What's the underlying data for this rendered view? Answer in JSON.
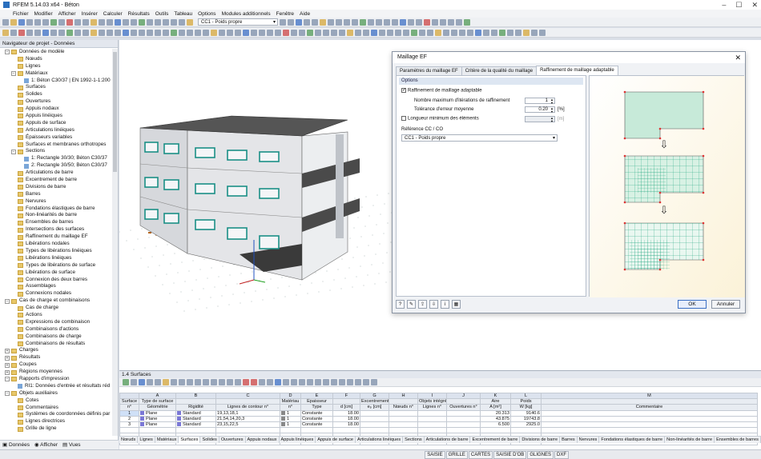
{
  "window": {
    "title": "RFEM 5.14.03 x64 - Béton"
  },
  "menu": [
    "Fichier",
    "Modifier",
    "Afficher",
    "Insérer",
    "Calculer",
    "Résultats",
    "Outils",
    "Tableau",
    "Options",
    "Modules additionnels",
    "Fenêtre",
    "Aide"
  ],
  "toolbar": {
    "loadcase": "CC1 - Poids propre"
  },
  "navigator": {
    "title": "Navigateur de projet - Données",
    "tabs": [
      "Données",
      "Afficher",
      "Vues"
    ],
    "items": [
      {
        "l": 0,
        "t": "f",
        "x": "−",
        "label": "Données de modèle"
      },
      {
        "l": 1,
        "t": "f",
        "x": "",
        "label": "Nœuds"
      },
      {
        "l": 1,
        "t": "f",
        "x": "",
        "label": "Lignes"
      },
      {
        "l": 1,
        "t": "f",
        "x": "−",
        "label": "Matériaux"
      },
      {
        "l": 2,
        "t": "i",
        "x": "",
        "label": "1: Béton C30/37 | EN 1992-1-1:200"
      },
      {
        "l": 1,
        "t": "f",
        "x": "",
        "label": "Surfaces"
      },
      {
        "l": 1,
        "t": "f",
        "x": "",
        "label": "Solides"
      },
      {
        "l": 1,
        "t": "f",
        "x": "",
        "label": "Ouvertures"
      },
      {
        "l": 1,
        "t": "f",
        "x": "",
        "label": "Appuis nodaux"
      },
      {
        "l": 1,
        "t": "f",
        "x": "",
        "label": "Appuis linéiques"
      },
      {
        "l": 1,
        "t": "f",
        "x": "",
        "label": "Appuis de surface"
      },
      {
        "l": 1,
        "t": "f",
        "x": "",
        "label": "Articulations linéiques"
      },
      {
        "l": 1,
        "t": "f",
        "x": "",
        "label": "Épaisseurs variables"
      },
      {
        "l": 1,
        "t": "f",
        "x": "",
        "label": "Surfaces et membranes orthotropes"
      },
      {
        "l": 1,
        "t": "f",
        "x": "−",
        "label": "Sections"
      },
      {
        "l": 2,
        "t": "i",
        "x": "",
        "label": "1: Rectangle 30/30; Béton C30/37"
      },
      {
        "l": 2,
        "t": "i",
        "x": "",
        "label": "2: Rectangle 30/50; Béton C30/37"
      },
      {
        "l": 1,
        "t": "f",
        "x": "",
        "label": "Articulations de barre"
      },
      {
        "l": 1,
        "t": "f",
        "x": "",
        "label": "Excentrement de barre"
      },
      {
        "l": 1,
        "t": "f",
        "x": "",
        "label": "Divisions de barre"
      },
      {
        "l": 1,
        "t": "f",
        "x": "",
        "label": "Barres"
      },
      {
        "l": 1,
        "t": "f",
        "x": "",
        "label": "Nervures"
      },
      {
        "l": 1,
        "t": "f",
        "x": "",
        "label": "Fondations élastiques de barre"
      },
      {
        "l": 1,
        "t": "f",
        "x": "",
        "label": "Non-linéarités de barre"
      },
      {
        "l": 1,
        "t": "f",
        "x": "",
        "label": "Ensembles de barres"
      },
      {
        "l": 1,
        "t": "f",
        "x": "",
        "label": "Intersections des surfaces"
      },
      {
        "l": 1,
        "t": "f",
        "x": "",
        "label": "Raffinement du maillage EF"
      },
      {
        "l": 1,
        "t": "f",
        "x": "",
        "label": "Libérations nodales"
      },
      {
        "l": 1,
        "t": "f",
        "x": "",
        "label": "Types de libérations linéiques"
      },
      {
        "l": 1,
        "t": "f",
        "x": "",
        "label": "Libérations linéiques"
      },
      {
        "l": 1,
        "t": "f",
        "x": "",
        "label": "Types de libérations de surface"
      },
      {
        "l": 1,
        "t": "f",
        "x": "",
        "label": "Libérations de surface"
      },
      {
        "l": 1,
        "t": "f",
        "x": "",
        "label": "Connexion des deux barres"
      },
      {
        "l": 1,
        "t": "f",
        "x": "",
        "label": "Assemblages"
      },
      {
        "l": 1,
        "t": "f",
        "x": "",
        "label": "Connexions nodales"
      },
      {
        "l": 0,
        "t": "f",
        "x": "−",
        "label": "Cas de charge et combinaisons"
      },
      {
        "l": 1,
        "t": "f",
        "x": "",
        "label": "Cas de charge"
      },
      {
        "l": 1,
        "t": "f",
        "x": "",
        "label": "Actions"
      },
      {
        "l": 1,
        "t": "f",
        "x": "",
        "label": "Expressions de combinaison"
      },
      {
        "l": 1,
        "t": "f",
        "x": "",
        "label": "Combinaisons d'actions"
      },
      {
        "l": 1,
        "t": "f",
        "x": "",
        "label": "Combinaisons de charge"
      },
      {
        "l": 1,
        "t": "f",
        "x": "",
        "label": "Combinaisons de résultats"
      },
      {
        "l": 0,
        "t": "f",
        "x": "+",
        "label": "Charges"
      },
      {
        "l": 0,
        "t": "f",
        "x": "+",
        "label": "Résultats"
      },
      {
        "l": 0,
        "t": "f",
        "x": "+",
        "label": "Coupes"
      },
      {
        "l": 0,
        "t": "f",
        "x": "+",
        "label": "Régions moyennes"
      },
      {
        "l": 0,
        "t": "f",
        "x": "−",
        "label": "Rapports d'impression"
      },
      {
        "l": 1,
        "t": "i",
        "x": "",
        "label": "RI1: Données d'entrée et résultats réd"
      },
      {
        "l": 0,
        "t": "f",
        "x": "−",
        "label": "Objets auxiliaires"
      },
      {
        "l": 1,
        "t": "f",
        "x": "",
        "label": "Cotes"
      },
      {
        "l": 1,
        "t": "f",
        "x": "",
        "label": "Commentaires"
      },
      {
        "l": 1,
        "t": "f",
        "x": "",
        "label": "Systèmes de coordonnées définis par"
      },
      {
        "l": 1,
        "t": "f",
        "x": "",
        "label": "Lignes directrices"
      },
      {
        "l": 1,
        "t": "f",
        "x": "",
        "label": "Grille de ligne"
      }
    ]
  },
  "dialog": {
    "title": "Maillage EF",
    "tabs": [
      "Paramètres du maillage EF",
      "Critère de la qualité du maillage",
      "Raffinement de maillage adaptable"
    ],
    "group": "Options",
    "chk_adaptive": "Raffinement de maillage adaptable",
    "max_iter_label": "Nombre maximum d'itérations de raffinement",
    "max_iter_value": "1",
    "tol_label": "Tolérance d'erreur moyenne",
    "tol_value": "0.20",
    "tol_unit": "[%]",
    "min_len_label": "Longueur minimum des éléments",
    "min_len_unit": "[m]",
    "ref_label": "Référence CC / CO",
    "ref_value": "CC1 - Poids propre",
    "ok": "OK",
    "cancel": "Annuler",
    "arrow_glyph": "⇩"
  },
  "table": {
    "title": "1.4 Surfaces",
    "letters": [
      "A",
      "B",
      "C",
      "D",
      "E",
      "F",
      "G",
      "H",
      "I",
      "J",
      "K",
      "L",
      "M"
    ],
    "h1": [
      "Surface",
      "Type de surface",
      "",
      "",
      "Matériau",
      "Épaisseur",
      "",
      "Excentrement",
      "",
      "Objets intégrés",
      "",
      "Aire",
      "Poids",
      ""
    ],
    "h2": [
      "n°",
      "Géométrie",
      "Rigidité",
      "Lignes de contour n°",
      "n°",
      "Type",
      "d [cm]",
      "eₚ [cm]",
      "Nœuds n°",
      "Lignes n°",
      "Ouvertures n°",
      "A [m²]",
      "W [kg]",
      "Commentaire"
    ],
    "rows": [
      [
        "1",
        "Plane",
        "Standard",
        "19,13,18,1",
        "1",
        "Constante",
        "18.00",
        "",
        "",
        "",
        "",
        "20.313",
        "9140.6",
        ""
      ],
      [
        "2",
        "Plane",
        "Standard",
        "21,54,14,20,3",
        "1",
        "Constante",
        "18.00",
        "",
        "",
        "",
        "",
        "43.875",
        "19743.8",
        ""
      ],
      [
        "3",
        "Plane",
        "Standard",
        "23,15,22,5",
        "1",
        "Constante",
        "18.00",
        "",
        "",
        "",
        "",
        "6.500",
        "2925.0",
        ""
      ]
    ],
    "sheets": [
      "Nœuds",
      "Lignes",
      "Matériaux",
      "Surfaces",
      "Solides",
      "Ouvertures",
      "Appuis nodaux",
      "Appuis linéiques",
      "Appuis de surface",
      "Articulations linéiques",
      "Sections",
      "Articulations de barre",
      "Excentrement de barre",
      "Divisions de barre",
      "Barres",
      "Nervures",
      "Fondations élastiques de barre",
      "Non-linéarités de barre",
      "Ensembles de barres"
    ],
    "active_sheet": "Surfaces"
  },
  "status": [
    "SAISIE",
    "GRILLE",
    "CARTES",
    "SAISIE D'OB",
    "GLIGNES",
    "DXF"
  ],
  "colors": {
    "accent": "#3b6fc4",
    "mesh": "#1aa37a",
    "support": "#b5651d"
  }
}
